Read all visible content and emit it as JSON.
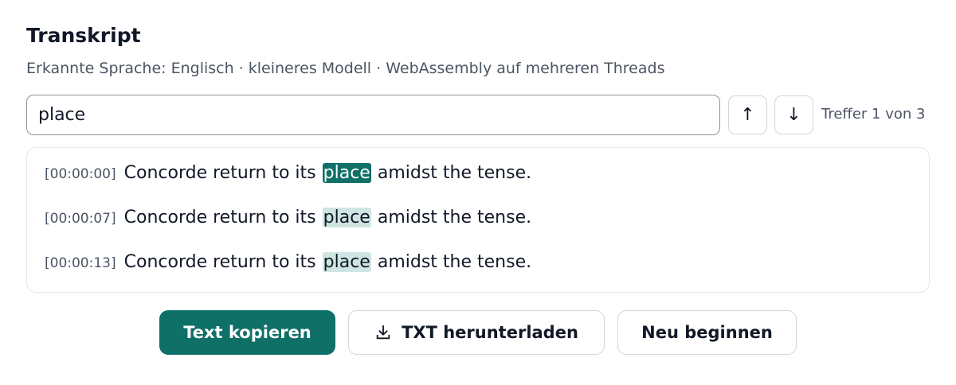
{
  "header": {
    "title": "Transkript",
    "subtitle": "Erkannte Sprache: Englisch · kleineres Modell · WebAssembly auf mehreren Threads"
  },
  "search": {
    "value": "place",
    "prev_label": "↑",
    "next_label": "↓",
    "match_status": "Treffer 1 von 3"
  },
  "transcript": {
    "lines": [
      {
        "timestamp": "[00:00:00]",
        "before": "Concorde return to its",
        "match": "place",
        "after": "amidst the tense.",
        "active": true
      },
      {
        "timestamp": "[00:00:07]",
        "before": "Concorde return to its",
        "match": "place",
        "after": "amidst the tense.",
        "active": false
      },
      {
        "timestamp": "[00:00:13]",
        "before": "Concorde return to its",
        "match": "place",
        "after": "amidst the tense.",
        "active": false
      }
    ]
  },
  "actions": {
    "copy_label": "Text kopieren",
    "download_label": "TXT herunterladen",
    "download_icon": "download-icon",
    "restart_label": "Neu beginnen"
  },
  "colors": {
    "accent": "#0f7068",
    "highlight": "#cfe5e1"
  }
}
